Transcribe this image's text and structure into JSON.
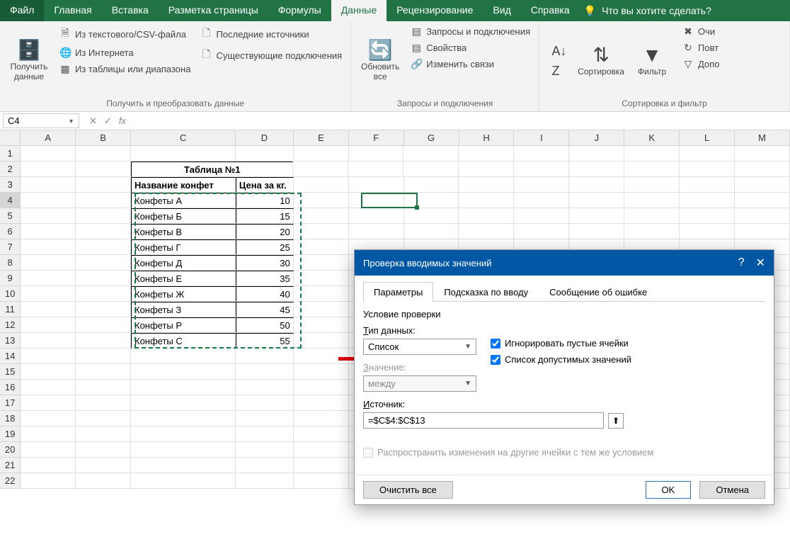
{
  "tabs": [
    "Файл",
    "Главная",
    "Вставка",
    "Разметка страницы",
    "Формулы",
    "Данные",
    "Рецензирование",
    "Вид",
    "Справка"
  ],
  "activeTab": "Данные",
  "tellme": "Что вы хотите сделать?",
  "ribbon": {
    "g1": {
      "getData": "Получить данные",
      "fromCsv": "Из текстового/CSV-файла",
      "fromWeb": "Из Интернета",
      "fromTable": "Из таблицы или диапазона",
      "recent": "Последние источники",
      "existing": "Существующие подключения",
      "title": "Получить и преобразовать данные"
    },
    "g2": {
      "refresh": "Обновить все",
      "queries": "Запросы и подключения",
      "props": "Свойства",
      "links": "Изменить связи",
      "title": "Запросы и подключения"
    },
    "g3": {
      "sort": "Сортировка",
      "filter": "Фильтр",
      "clear": "Очи",
      "reapply": "Повт",
      "advanced": "Допо",
      "title": "Сортировка и фильтр"
    }
  },
  "namebox": "C4",
  "formula": "",
  "cols": [
    "A",
    "B",
    "C",
    "D",
    "E",
    "F",
    "G",
    "H",
    "I",
    "J",
    "K",
    "L",
    "M"
  ],
  "rowcount": 22,
  "table": {
    "title": "Таблица №1",
    "h1": "Название конфет",
    "h2": "Цена за кг.",
    "rows": [
      {
        "n": "Конфеты А",
        "p": "10"
      },
      {
        "n": "Конфеты Б",
        "p": "15"
      },
      {
        "n": "Конфеты В",
        "p": "20"
      },
      {
        "n": "Конфеты Г",
        "p": "25"
      },
      {
        "n": "Конфеты Д",
        "p": "30"
      },
      {
        "n": "Конфеты Е",
        "p": "35"
      },
      {
        "n": "Конфеты Ж",
        "p": "40"
      },
      {
        "n": "Конфеты З",
        "p": "45"
      },
      {
        "n": "Конфеты Р",
        "p": "50"
      },
      {
        "n": "Конфеты С",
        "p": "55"
      }
    ]
  },
  "dialog": {
    "title": "Проверка вводимых значений",
    "tabs": [
      "Параметры",
      "Подсказка по вводу",
      "Сообщение об ошибке"
    ],
    "section": "Условие проверки",
    "typeLabel": "Тип данных:",
    "typeValue": "Список",
    "valueLabel": "Значение:",
    "valueValue": "между",
    "ignore": "Игнорировать пустые ячейки",
    "inlist": "Список допустимых значений",
    "sourceLabel": "Источник:",
    "sourceValue": "=$C$4:$C$13",
    "spread": "Распространить изменения на другие ячейки с тем же условием",
    "clear": "Очистить все",
    "ok": "OK",
    "cancel": "Отмена"
  }
}
